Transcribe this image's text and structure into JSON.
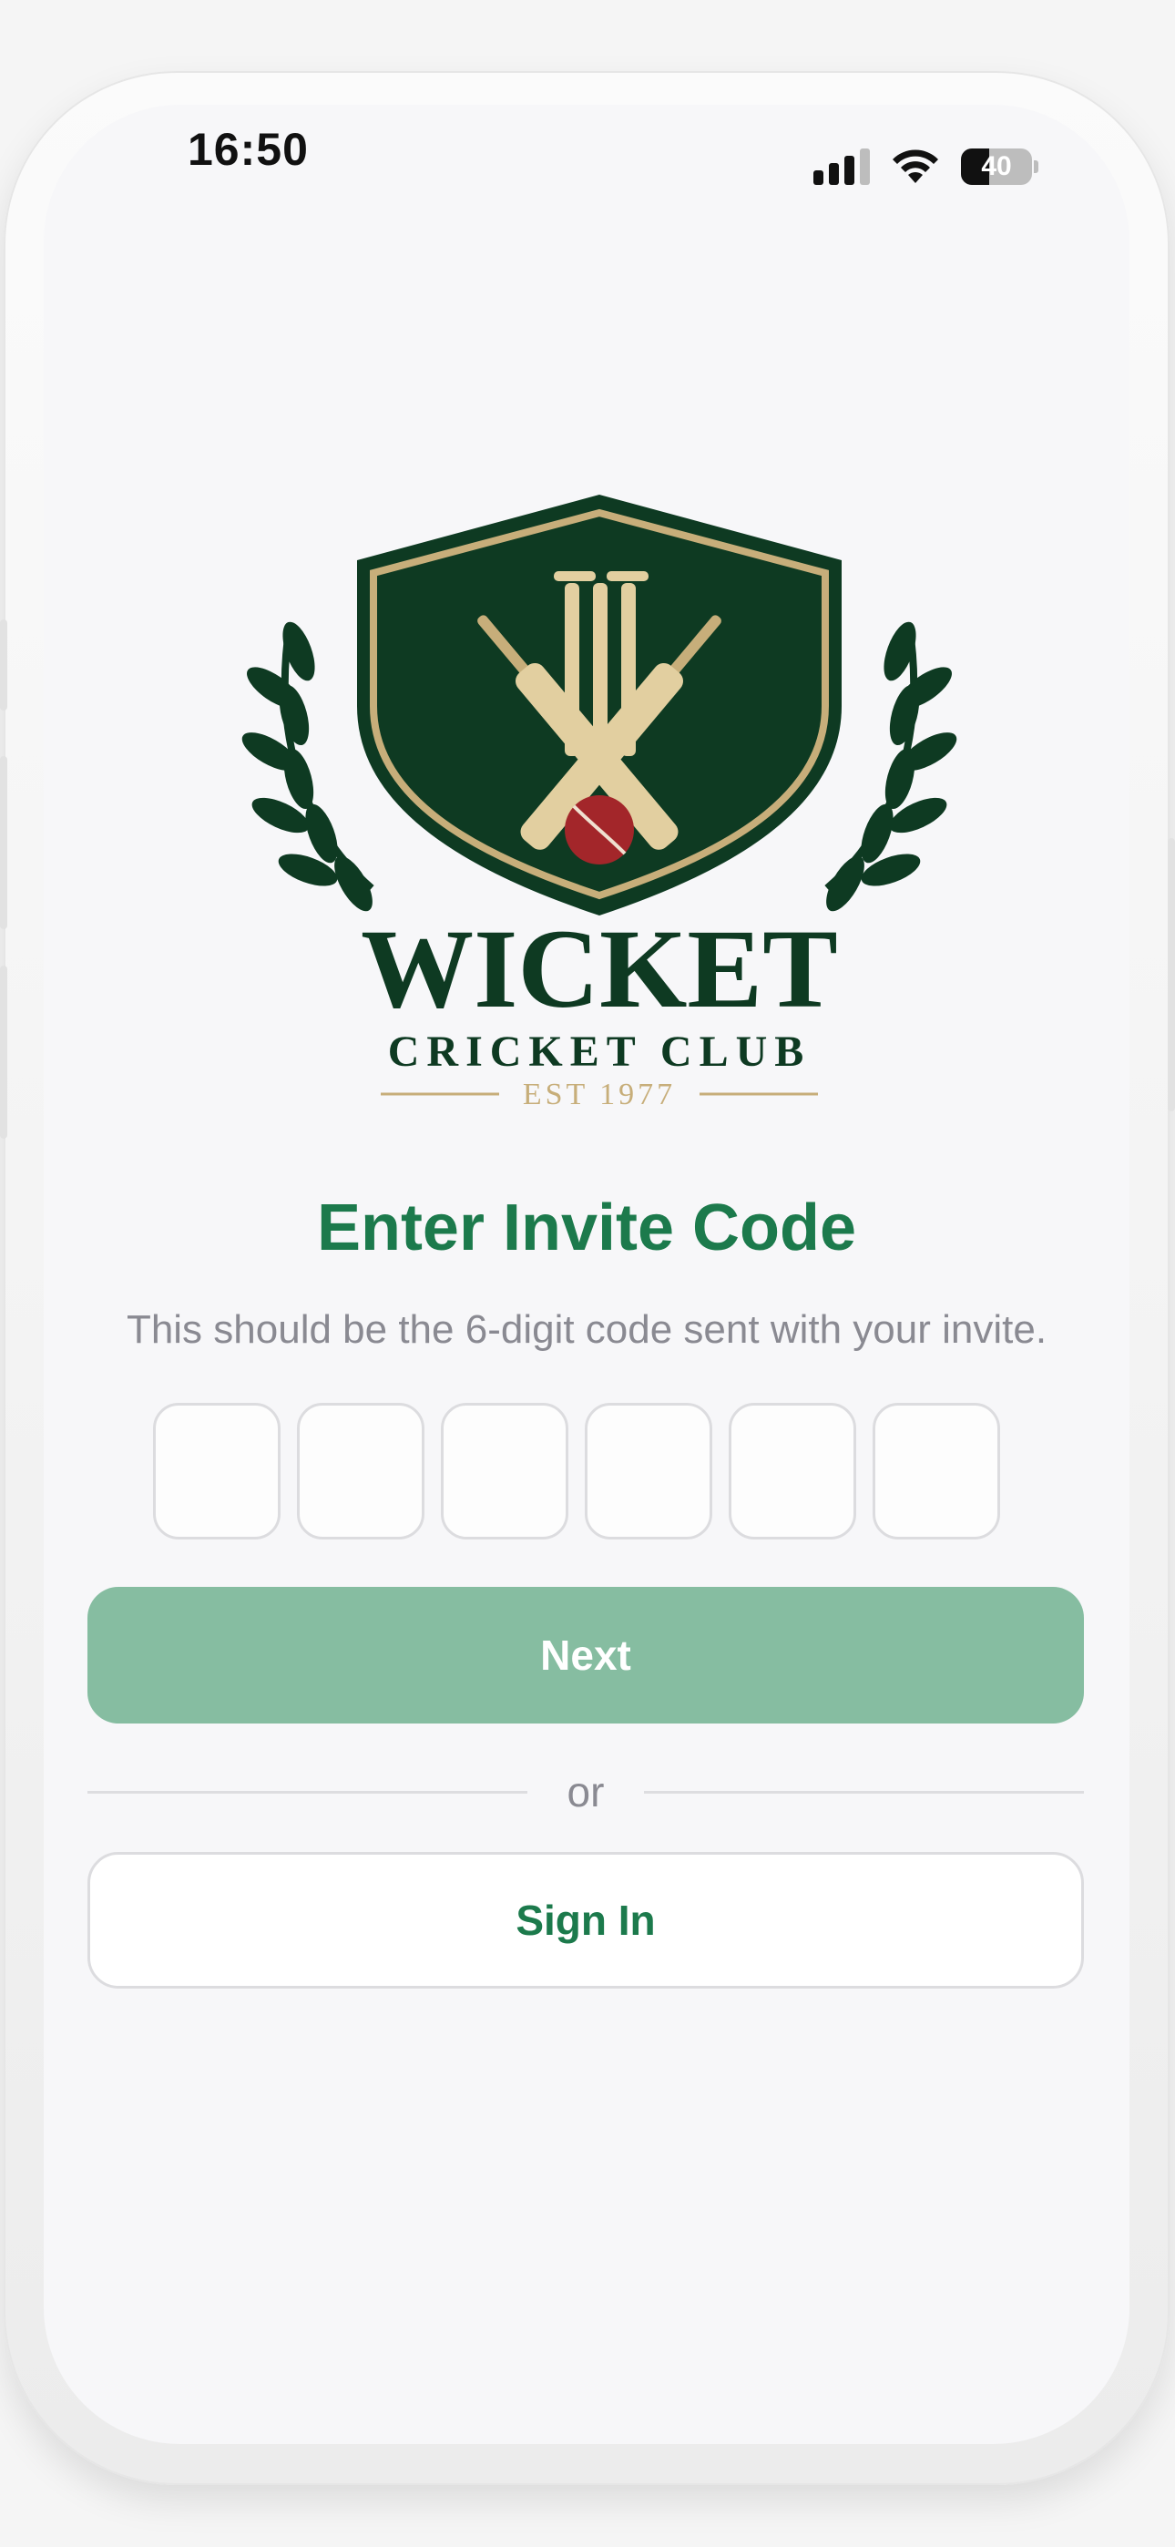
{
  "status_bar": {
    "time": "16:50",
    "battery": "40",
    "battery_level": 0.4
  },
  "logo": {
    "name": "WICKET",
    "subname": "CRICKET CLUB",
    "established": "EST 1977"
  },
  "invite": {
    "title": "Enter Invite Code",
    "subtitle": "This should be the 6-digit code sent with your invite.",
    "code_digits": [
      "",
      "",
      "",
      "",
      "",
      ""
    ]
  },
  "actions": {
    "next_label": "Next",
    "or_label": "or",
    "sign_in_label": "Sign In"
  },
  "colors": {
    "accent": "#1c7a4c",
    "accent_disabled": "#86bda1",
    "logo_green": "#0e3a22",
    "logo_gold": "#c7ae7a",
    "ball_red": "#a3262a"
  },
  "icons": {
    "signal": "cellular-signal-icon",
    "wifi": "wifi-icon",
    "battery": "battery-icon"
  }
}
